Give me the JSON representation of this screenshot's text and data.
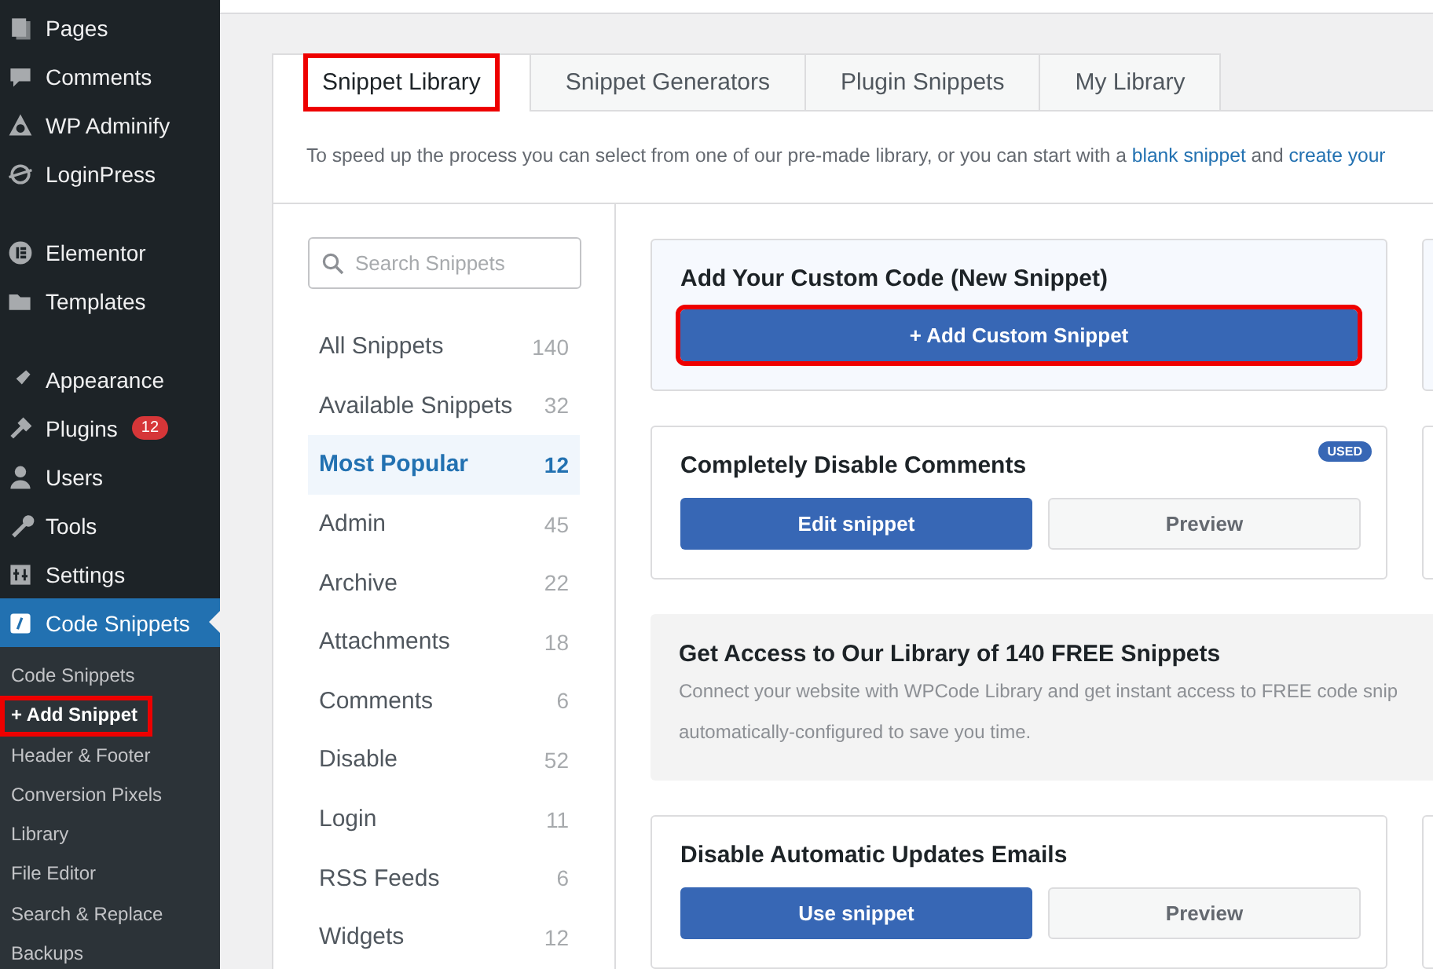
{
  "sidebar": {
    "groups": [
      {
        "items": [
          {
            "label": "Pages",
            "selected": false
          },
          {
            "label": "Comments",
            "selected": false
          },
          {
            "label": "WP Adminify",
            "selected": false
          },
          {
            "label": "LoginPress",
            "selected": false
          }
        ]
      },
      {
        "items": [
          {
            "label": "Elementor",
            "selected": false
          },
          {
            "label": "Templates",
            "selected": false
          }
        ]
      },
      {
        "items": [
          {
            "label": "Appearance",
            "selected": false
          },
          {
            "label": "Plugins",
            "badge": "12",
            "selected": false
          },
          {
            "label": "Users",
            "selected": false
          },
          {
            "label": "Tools",
            "selected": false
          },
          {
            "label": "Settings",
            "selected": false
          },
          {
            "label": "Code Snippets",
            "selected": true,
            "submenu": [
              {
                "label": "Code Snippets",
                "selected": false,
                "highlighted": false
              },
              {
                "label": "+ Add Snippet",
                "selected": true,
                "highlighted": true
              },
              {
                "label": "Header & Footer",
                "selected": false,
                "highlighted": false
              },
              {
                "label": "Conversion Pixels",
                "selected": false,
                "highlighted": false
              },
              {
                "label": "Library",
                "selected": false,
                "highlighted": false
              },
              {
                "label": "File Editor",
                "selected": false,
                "highlighted": false
              },
              {
                "label": "Search & Replace",
                "selected": false,
                "highlighted": false
              },
              {
                "label": "Backups",
                "selected": false,
                "highlighted": false
              }
            ]
          }
        ]
      }
    ]
  },
  "tabs": [
    {
      "label": "Snippet Library",
      "selected": true,
      "highlighted": true
    },
    {
      "label": "Snippet Generators",
      "selected": false,
      "highlighted": false
    },
    {
      "label": "Plugin Snippets",
      "selected": false,
      "highlighted": false
    },
    {
      "label": "My Library",
      "selected": false,
      "highlighted": false
    }
  ],
  "intro": [
    {
      "kind": "text",
      "text": "To speed up the process you can select from one of our pre-made library, or you can start with a"
    },
    {
      "kind": "link",
      "text": "blank snippet"
    },
    {
      "kind": "text",
      "text": "and"
    },
    {
      "kind": "link",
      "text": "create your"
    }
  ],
  "categories": {
    "search": {
      "placeholder": "Search Snippets"
    },
    "items": [
      {
        "label": "All Snippets",
        "count": "140",
        "selected": false
      },
      {
        "label": "Available Snippets",
        "count": "32",
        "selected": false
      },
      {
        "label": "Most Popular",
        "count": "12",
        "selected": true
      },
      {
        "label": "Admin",
        "count": "45",
        "selected": false
      },
      {
        "label": "Archive",
        "count": "22",
        "selected": false
      },
      {
        "label": "Attachments",
        "count": "18",
        "selected": false
      },
      {
        "label": "Comments",
        "count": "6",
        "selected": false
      },
      {
        "label": "Disable",
        "count": "52",
        "selected": false
      },
      {
        "label": "Login",
        "count": "11",
        "selected": false
      },
      {
        "label": "RSS Feeds",
        "count": "6",
        "selected": false
      },
      {
        "label": "Widgets",
        "count": "12",
        "selected": false
      }
    ]
  },
  "cards": [
    {
      "kind": "custom",
      "title": "Add Your Custom Code (New Snippet)",
      "button": {
        "label": "+ Add Custom Snippet",
        "highlighted": true
      }
    },
    {
      "kind": "snippet",
      "title": "Completely Disable Comments",
      "badge": "USED",
      "primary": "Edit snippet",
      "secondary": "Preview"
    },
    {
      "kind": "promo",
      "title": "Get Access to Our Library of 140 FREE Snippets",
      "lines": [
        "Connect your website with WPCode Library and get instant access to FREE code snip",
        "automatically-configured to save you time."
      ]
    },
    {
      "kind": "snippet",
      "title": "Disable Automatic Updates Emails",
      "primary": "Use snippet",
      "secondary": "Preview"
    }
  ]
}
